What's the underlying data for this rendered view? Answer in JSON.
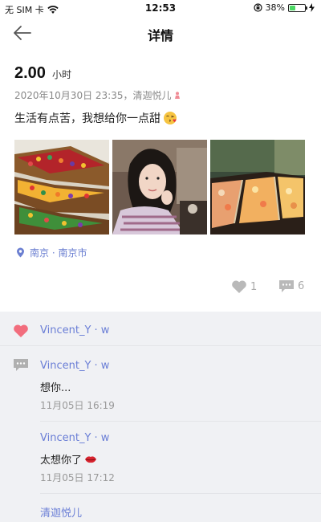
{
  "status_bar": {
    "carrier": "无 SIM 卡",
    "time": "12:53",
    "battery_percent": "38%",
    "battery_level": 0.38
  },
  "nav": {
    "title": "详情"
  },
  "post": {
    "duration_value": "2.00",
    "duration_unit": "小时",
    "meta": "2020年10月30日 23:35，清迦悦儿",
    "text": "生活有点苦，我想给你一点甜",
    "location": "南京 · 南京市",
    "like_count": "1",
    "comment_count": "6"
  },
  "interactions": {
    "like_user": "Vincent_Y · w",
    "comments": [
      {
        "user": "Vincent_Y · w",
        "text": "想你...",
        "time": "11月05日 16:19"
      },
      {
        "user": "Vincent_Y · w",
        "text": "太想你了",
        "time": "11月05日 17:12"
      },
      {
        "user": "清迦悦儿"
      }
    ]
  },
  "colors": {
    "accent": "#6a7ed6",
    "heart": "#f26d7d",
    "muted": "#aaaaaa",
    "panel_bg": "#f0f1f4"
  }
}
